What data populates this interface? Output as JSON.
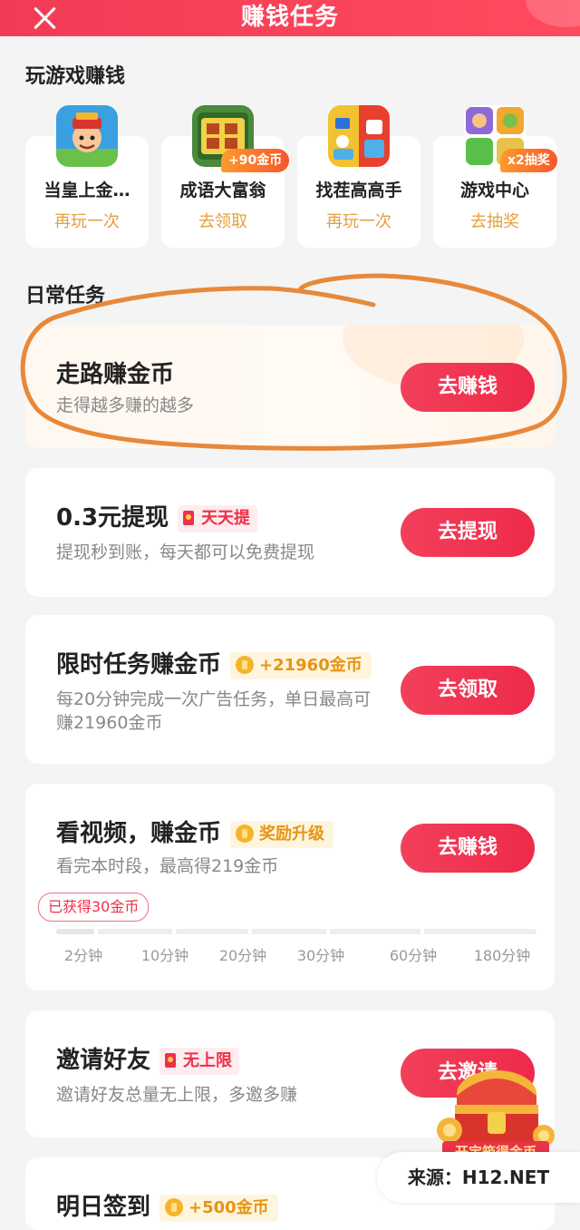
{
  "header": {
    "title": "赚钱任务"
  },
  "games_section": {
    "title": "玩游戏赚钱"
  },
  "games": [
    {
      "name": "当皇上金…",
      "action": "再玩一次",
      "badge": ""
    },
    {
      "name": "成语大富翁",
      "action": "去领取",
      "badge": "+90金币"
    },
    {
      "name": "找茬高高手",
      "action": "再玩一次",
      "badge": ""
    },
    {
      "name": "游戏中心",
      "action": "去抽奖",
      "badge": "x2抽奖"
    }
  ],
  "daily_section": {
    "title": "日常任务"
  },
  "tasks": {
    "walk": {
      "title": "走路赚金币",
      "desc": "走得越多赚的越多",
      "button": "去赚钱"
    },
    "withdraw": {
      "title": "0.3元提现",
      "tag": "天天提",
      "desc": "提现秒到账，每天都可以免费提现",
      "button": "去提现"
    },
    "limited": {
      "title": "限时任务赚金币",
      "tag": "+21960金币",
      "desc": "每20分钟完成一次广告任务，单日最高可赚21960金币",
      "button": "去领取"
    },
    "video": {
      "title": "看视频，赚金币",
      "tag": "奖励升级",
      "desc": "看完本时段，最高得219金币",
      "button": "去赚钱",
      "earned": "已获得30金币",
      "ticks": [
        "2分钟",
        "10分钟",
        "20分钟",
        "30分钟",
        "60分钟",
        "180分钟"
      ],
      "progress": 0.08
    },
    "invite": {
      "title": "邀请好友",
      "tag": "无上限",
      "desc": "邀请好友总量无上限，多邀多赚",
      "button": "去邀请"
    },
    "signin": {
      "title": "明日签到",
      "tag": "+500金币"
    }
  },
  "floating": {
    "chest_label": "开宝箱得金币"
  },
  "watermark": {
    "text": "来源：H12.NET"
  },
  "colors": {
    "accent": "#ee2a4a",
    "gold": "#e69412",
    "highlight_circle": "#e8883a"
  }
}
